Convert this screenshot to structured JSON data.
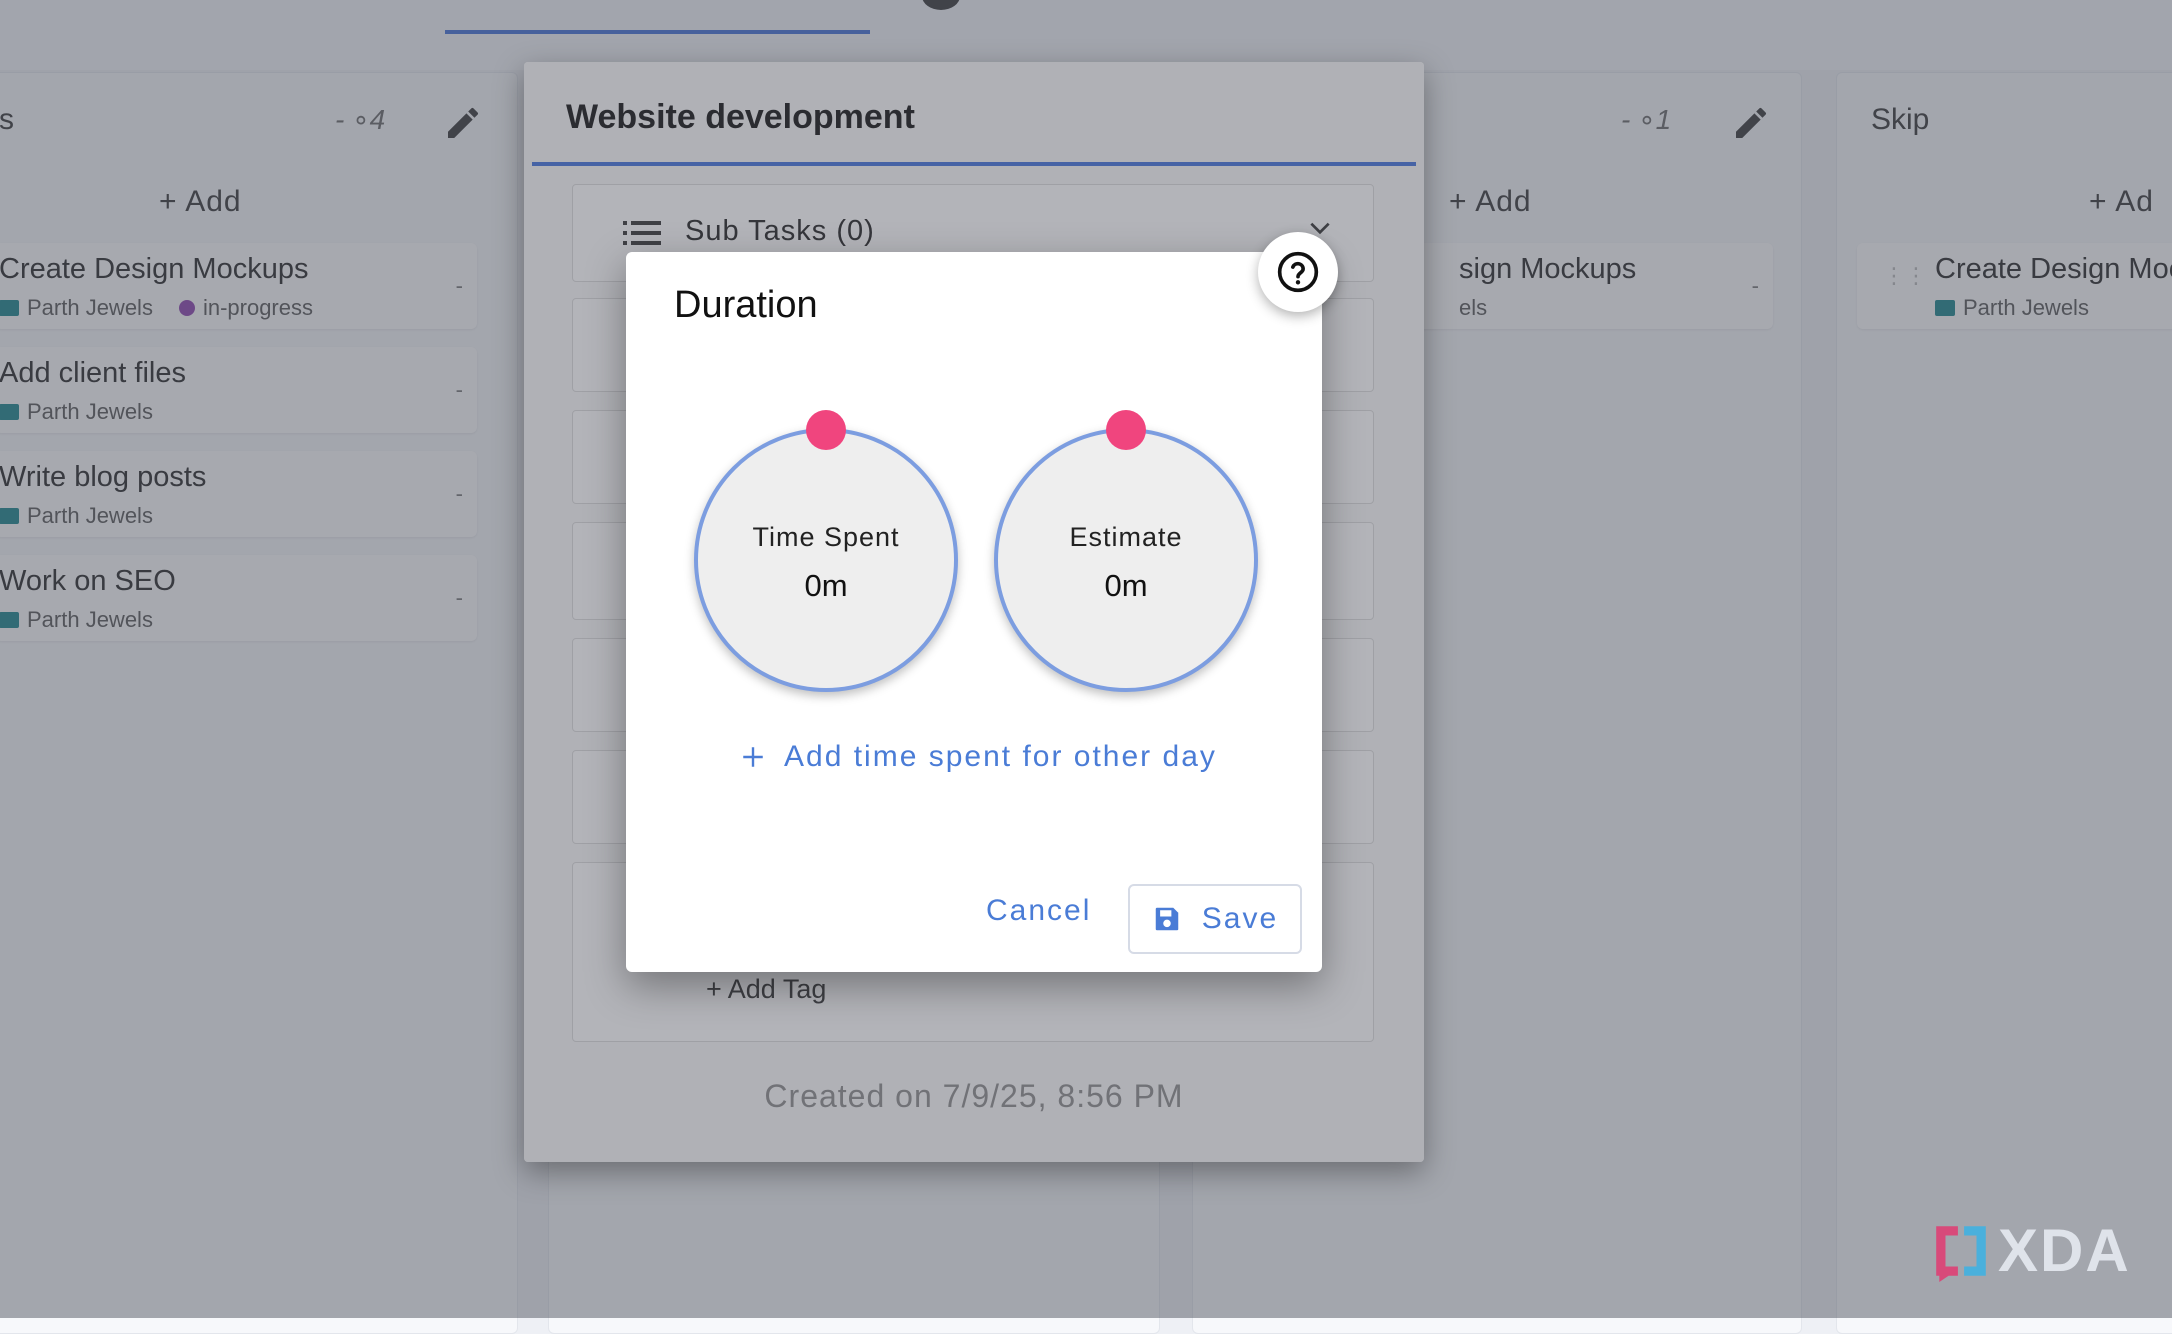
{
  "colors": {
    "accent": "#4a7cd6",
    "knob": "#f0457e",
    "dialRing": "#7c9de0",
    "folder": "#14828a",
    "tagPurple": "#8b3fae"
  },
  "board": {
    "columns": [
      {
        "title": "s",
        "count": "- ∘4",
        "add_label": "+  Add",
        "cards": [
          {
            "title": "Create Design Mockups",
            "project": "Parth Jewels",
            "tag": "in-progress",
            "dash": "-"
          },
          {
            "title": "Add client files",
            "project": "Parth Jewels",
            "dash": "-"
          },
          {
            "title": "Write blog posts",
            "project": "Parth Jewels",
            "dash": "-"
          },
          {
            "title": "Work on SEO",
            "project": "Parth Jewels",
            "dash": "-"
          }
        ]
      },
      {
        "title": "",
        "count": "- ∘1",
        "add_label": "+  Add",
        "cards": [
          {
            "title": "sign Mockups",
            "project": "els",
            "dash": "-"
          }
        ]
      },
      {
        "title": "Skip",
        "add_label": "+  Ad",
        "cards": [
          {
            "title": "Create Design Moc",
            "project": "Parth Jewels"
          }
        ]
      }
    ]
  },
  "task_dialog": {
    "title": "Website development",
    "subtasks_label": "Sub Tasks (0)",
    "add_tag": "+ Add Tag",
    "created": "Created on 7/9/25, 8:56 PM"
  },
  "duration_dialog": {
    "title": "Duration",
    "help_icon": "help-circle-icon",
    "time_spent": {
      "label": "Time Spent",
      "value": "0m"
    },
    "estimate": {
      "label": "Estimate",
      "value": "0m"
    },
    "add_time_label": "Add time spent for other day",
    "cancel_label": "Cancel",
    "save_label": "Save"
  },
  "watermark": {
    "text": "XDA"
  }
}
